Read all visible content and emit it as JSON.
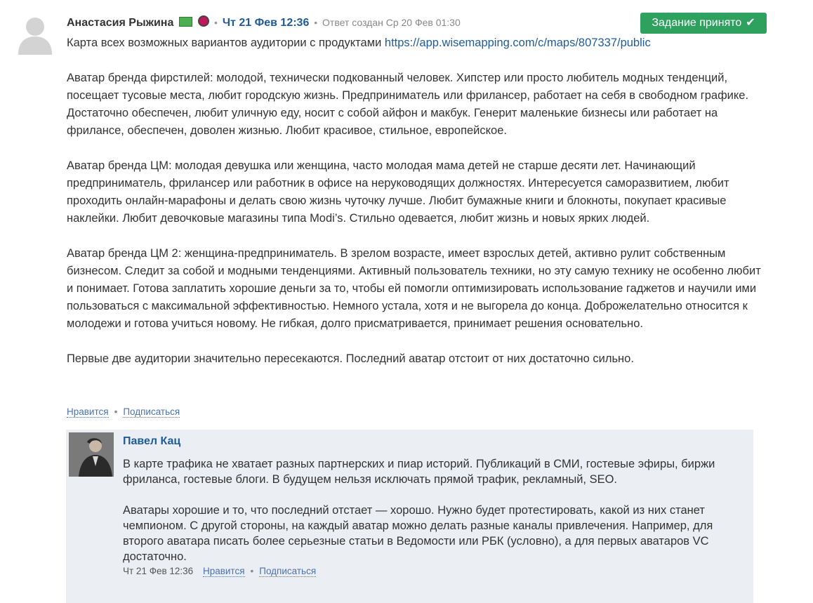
{
  "post": {
    "author": "Анастасия Рыжина",
    "datetime": "Чт 21 Фев 12:36",
    "created": "Ответ создан Ср 20 Фев 01:30",
    "accepted_label": "Задание принято",
    "check_glyph": "✔",
    "intro": "Карта всех возможных вариантов аудитории с продуктами ",
    "link": "https://app.wisemapping.com/c/maps/807337/public",
    "paragraphs": [
      "Аватар бренда фирстилей: молодой, технически подкованный человек. Хипстер или просто любитель модных тенденций, посещает тусовые места, любит городскую жизнь. Предприниматель или фрилансер, работает на себя в свободном графике. Достаточно обеспечен, любит уличную еду, носит с собой айфон и макбук. Генерит маленькие бизнесы или работает на фрилансе, обеспечен, доволен жизнью. Любит красивое, стильное, европейское.",
      "Аватар бренда ЦМ: молодая девушка или женщина, часто молодая мама детей не старше десяти лет. Начинающий предприниматель, фрилансер или работник в офисе на неруководящих должностях. Интересуется саморазвитием, любит проходить онлайн-марафоны и делать свою жизнь чуточку лучше. Любит бумажные книги и блокноты, покупает красивые наклейки. Любит девочковые магазины типа Modi’s. Стильно одевается, любит жизнь и новых ярких людей.",
      "Аватар бренда ЦМ 2: женщина-предприниматель. В зрелом возрасте, имеет взрослых детей, активно рулит собственным бизнесом. Следит за собой и модными тенденциями. Активный пользователь техники, но эту самую технику не особенно любит и понимает. Готова заплатить хорошие деньги за то, чтобы ей помогли оптимизировать использование гаджетов и научили ими пользоваться с максимальной эффективностью. Немного устала, хотя и не выгорела до конца. Доброжелательно относится к молодежи и готова учиться новому. Не гибкая, долго присматривается, принимает решения основательно.",
      "Первые две аудитории значительно пересекаются. Последний аватар отстоит от них достаточно сильно."
    ],
    "like_label": "Нравится",
    "subscribe_label": "Подписаться",
    "separator": "•"
  },
  "reply": {
    "author": "Павел Кац",
    "paragraphs": [
      "В карте трафика не хватает разных партнерских и пиар историй. Публикаций в СМИ, гостевые эфиры, биржи фриланса, гостевые блоги. В будущем нельзя исключать прямой трафик, рекламный, SEO.",
      "Аватары хорошие и то, что последний отстает — хорошо. Нужно будет протестировать, какой из них станет чемпионом. С другой стороны, на каждый аватар можно делать разные каналы привлечения. Например, для второго аватара писать более серьезные статьи в Ведомости или РБК (условно), а для первых аватаров VC достаточно."
    ],
    "time": "Чт 21 Фев 12:36",
    "like_label": "Нравится",
    "subscribe_label": "Подписаться",
    "separator": "•"
  },
  "colors": {
    "accent_blue": "#1f5b99",
    "link_blue": "#4a73b0",
    "accepted_green": "#2fa15f",
    "reply_bg": "#ebeef3"
  },
  "icons": {
    "author_avatar": "default-user-silhouette-icon",
    "badge1": "money-badge-icon",
    "badge2": "round-medal-icon",
    "check": "checkmark-icon"
  }
}
